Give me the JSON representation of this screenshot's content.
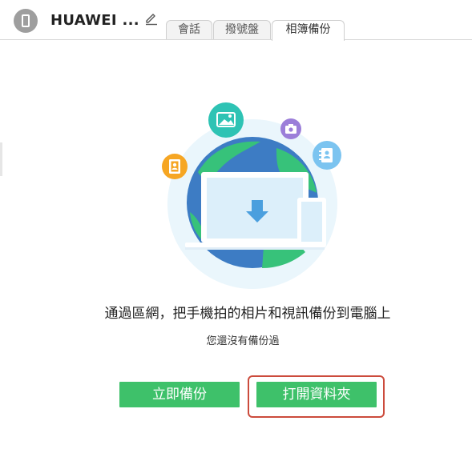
{
  "header": {
    "device_name": "HUAWEI ...",
    "device_icon": "phone-icon",
    "edit_icon": "pencil-icon"
  },
  "tabs": [
    {
      "label": "會話",
      "active": false
    },
    {
      "label": "撥號盤",
      "active": false
    },
    {
      "label": "相簿備份",
      "active": true
    }
  ],
  "illustration": {
    "icons": [
      "image-icon",
      "camera-icon",
      "contacts-icon",
      "backup-file-icon",
      "download-arrow-icon"
    ],
    "colors": {
      "globe_bg": "#e6f4fb",
      "ocean": "#3d7cc4",
      "land": "#37c27a",
      "laptop": "#dceffa",
      "arrow": "#4a9fde",
      "image_circle": "#2ec3b4",
      "camera_circle": "#9b7ed9",
      "contacts_circle": "#7cc4f0",
      "file_circle": "#f6a623"
    }
  },
  "main": {
    "title": "通過區網，把手機拍的相片和視訊備份到電腦上",
    "subtitle": "您還沒有備份過"
  },
  "buttons": {
    "backup_now": "立即備份",
    "open_folder": "打開資料夾"
  },
  "colors": {
    "accent_green": "#3ec16a",
    "highlight_red": "#cc4b3c"
  }
}
